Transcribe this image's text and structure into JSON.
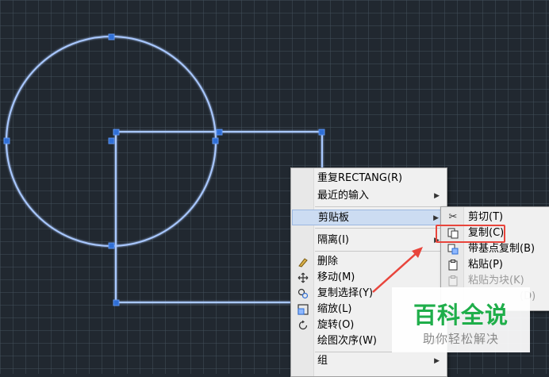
{
  "context_menu": {
    "items": [
      {
        "label": "重复RECTANG(R)"
      },
      {
        "label": "最近的输入",
        "submenu": true
      },
      {
        "label": "剪贴板",
        "submenu": true,
        "highlighted": true
      },
      {
        "label": "隔离(I)",
        "submenu": true
      },
      {
        "label": "删除",
        "icon": "eraser-icon"
      },
      {
        "label": "移动(M)",
        "icon": "move-icon"
      },
      {
        "label": "复制选择(Y)",
        "icon": "copy-selection-icon"
      },
      {
        "label": "缩放(L)",
        "icon": "scale-icon"
      },
      {
        "label": "旋转(O)",
        "icon": "rotate-icon"
      },
      {
        "label": "绘图次序(W)",
        "submenu": true
      },
      {
        "label": "组",
        "submenu": true
      }
    ]
  },
  "clipboard_submenu": {
    "items": [
      {
        "label": "剪切(T)",
        "icon": "scissors-icon"
      },
      {
        "label": "复制(C)",
        "icon": "copy-icon"
      },
      {
        "label": "带基点复制(B)",
        "icon": "copy-basepoint-icon"
      },
      {
        "label": "粘贴(P)",
        "icon": "paste-icon"
      },
      {
        "label": "粘贴为块(K)",
        "icon": "paste-block-icon",
        "disabled": true
      },
      {
        "label": "(D)",
        "disabled": true
      }
    ]
  },
  "watermark": {
    "title": "百科全说",
    "subtitle": "助你轻松解决"
  },
  "colors": {
    "canvas": "#212830",
    "geometry": "#8fb8ff",
    "grip": "#2f6fd6",
    "annotation": "#e8453c",
    "watermark_green": "#1fae4a"
  }
}
